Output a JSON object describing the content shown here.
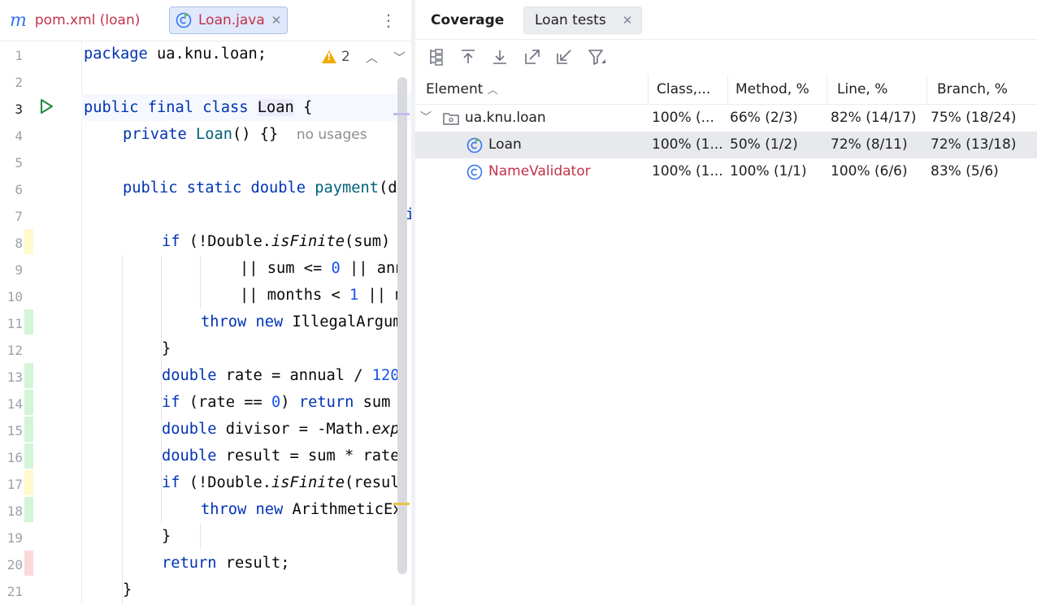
{
  "editor": {
    "tabs": [
      {
        "icon": "m",
        "label": "pom.xml (loan)"
      },
      {
        "label": "Loan.java",
        "active": true
      }
    ],
    "warning_count": "2",
    "no_usages_hint": "no usages",
    "line_numbers": [
      "1",
      "2",
      "3",
      "4",
      "5",
      "6",
      "7",
      "8",
      "9",
      "10",
      "11",
      "12",
      "13",
      "14",
      "15",
      "16",
      "17",
      "18",
      "19",
      "20",
      "21"
    ],
    "code": {
      "l1_kw": "package",
      "l1_rest": " ua.knu.loan;",
      "l3_kw": "public final class",
      "l3_cls": "Loan",
      "l3_rest": " {",
      "l4_kw": "private",
      "l4_fn": "Loan",
      "l4_rest": "() {}",
      "l6_kw": "public static double",
      "l6_fn": "payment",
      "l6_rest": "(d",
      "l7_rest": "i",
      "l8_kw": "if",
      "l8_a": " (!Double.",
      "l8_it": "isFinite",
      "l8_b": "(sum)",
      "l9_a": "|| sum <= ",
      "l9_n": "0",
      "l9_b": " || ann",
      "l10_a": "|| months < ",
      "l10_n": "1",
      "l10_b": " || m",
      "l11_kw": "throw new",
      "l11_rest": " IllegalArgum",
      "l12_rest": "}",
      "l13_kw": "double",
      "l13_a": " rate = annual / ",
      "l13_n": "120",
      "l14_kw": "if",
      "l14_a": " (rate == ",
      "l14_n": "0",
      "l14_b": ") ",
      "l14_kw2": "return",
      "l14_c": " sum",
      "l15_kw": "double",
      "l15_a": " divisor = -Math.",
      "l15_it": "exp",
      "l16_kw": "double",
      "l16_a": " result = sum * rate",
      "l17_kw": "if",
      "l17_a": " (!Double.",
      "l17_it": "isFinite",
      "l17_b": "(resul",
      "l18_kw": "throw new",
      "l18_rest": " ArithmeticEx",
      "l19_rest": "}",
      "l20_kw": "return",
      "l20_rest": " result;",
      "l21_rest": "}"
    },
    "coverage_marks": [
      {
        "line": 8,
        "status": "partial"
      },
      {
        "line": 11,
        "status": "covered"
      },
      {
        "line": 13,
        "status": "covered"
      },
      {
        "line": 14,
        "status": "covered"
      },
      {
        "line": 15,
        "status": "covered"
      },
      {
        "line": 16,
        "status": "covered"
      },
      {
        "line": 17,
        "status": "partial"
      },
      {
        "line": 18,
        "status": "covered"
      },
      {
        "line": 20,
        "status": "uncovered"
      }
    ]
  },
  "coverage": {
    "title": "Coverage",
    "tab_label": "Loan tests",
    "toolbar_icons": [
      "flatten-packages-icon",
      "navigate-up-icon",
      "navigate-down-icon",
      "export-report-icon",
      "import-report-icon",
      "filter-icon"
    ],
    "columns": [
      "Element",
      "Class,...",
      "Method, %",
      "Line, %",
      "Branch, %"
    ],
    "rows": [
      {
        "name": "ua.knu.loan",
        "class": "100% (...",
        "method": "66% (2/3)",
        "line": "82% (14/17)",
        "branch": "75% (18/24)",
        "kind": "package"
      },
      {
        "name": "Loan",
        "class": "100% (1...",
        "method": "50% (1/2)",
        "line": "72% (8/11)",
        "branch": "72% (13/18)",
        "kind": "class-test",
        "selected": true
      },
      {
        "name": "NameValidator",
        "class": "100% (1...",
        "method": "100% (1/1)",
        "line": "100% (6/6)",
        "branch": "83% (5/6)",
        "kind": "class"
      }
    ],
    "colors": {
      "accent": "#3574f0",
      "covered": "#d3f5d6",
      "partial": "#fff9cc",
      "uncovered": "#fcd9d9",
      "error_name": "#c2324a"
    }
  }
}
